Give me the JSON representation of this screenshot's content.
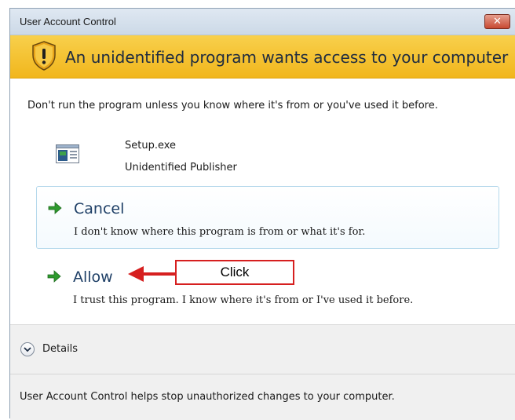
{
  "window": {
    "title": "User Account Control",
    "close_glyph": "✕"
  },
  "banner": {
    "text": "An unidentified program wants access to your computer",
    "icon": "shield-warning-icon"
  },
  "message": {
    "warning": "Don't run the program unless you know where it's from or you've used it before."
  },
  "program": {
    "name": "Setup.exe",
    "publisher": "Unidentified Publisher",
    "icon": "application-icon"
  },
  "commands": {
    "cancel": {
      "label": "Cancel",
      "description": "I don't know where this program is from or what it's for."
    },
    "allow": {
      "label": "Allow",
      "description": "I trust this program. I know where it's from or I've used it before."
    }
  },
  "annotation": {
    "label": "Click",
    "color": "#d61f1f"
  },
  "details": {
    "label": "Details"
  },
  "footer": {
    "text": "User Account Control helps stop unauthorized changes to your computer."
  },
  "colors": {
    "banner": "#f4c030",
    "command_arrow": "#2e9a2e",
    "command_label": "#1e3f66"
  }
}
